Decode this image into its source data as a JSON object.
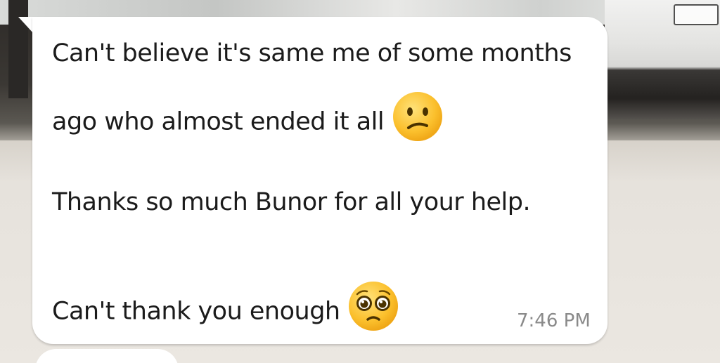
{
  "message": {
    "line1": "Can't believe it's same me of some months",
    "line2": "ago who almost ended it all",
    "line3": "Thanks so much Bunor for all your help.",
    "line4": "Can't thank you enough",
    "timestamp": "7:46 PM",
    "emoji_line2": "confused-face-icon",
    "emoji_line4": "pleading-face-icon"
  },
  "colors": {
    "bubble": "#ffffff",
    "text": "#1b1b1b",
    "timestamp": "#8a8a8a",
    "emoji_face": "#fbc02d"
  }
}
